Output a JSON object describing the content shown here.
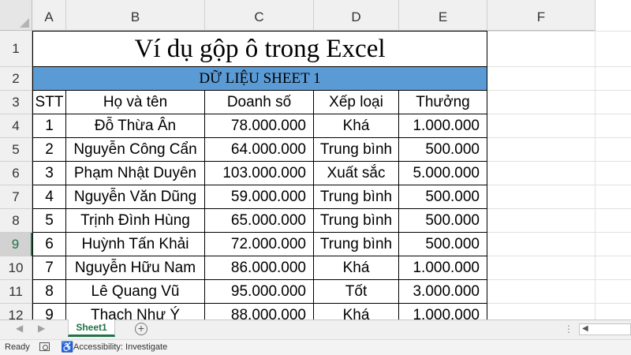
{
  "columns": [
    "A",
    "B",
    "C",
    "D",
    "E",
    "F"
  ],
  "rows": [
    "1",
    "2",
    "3",
    "4",
    "5",
    "6",
    "7",
    "8",
    "9",
    "10",
    "11",
    "12"
  ],
  "sheet": {
    "title": "Ví dụ gộp ô trong Excel",
    "band": "DỮ LIỆU SHEET 1",
    "headers": [
      "STT",
      "Họ và tên",
      "Doanh số",
      "Xếp loại",
      "Thưởng"
    ],
    "data": [
      [
        "1",
        "Đỗ Thừa Ân",
        "78.000.000",
        "Khá",
        "1.000.000"
      ],
      [
        "2",
        "Nguyễn Công Cẩn",
        "64.000.000",
        "Trung bình",
        "500.000"
      ],
      [
        "3",
        "Phạm Nhật Duyên",
        "103.000.000",
        "Xuất sắc",
        "5.000.000"
      ],
      [
        "4",
        "Nguyễn Văn Dũng",
        "59.000.000",
        "Trung bình",
        "500.000"
      ],
      [
        "5",
        "Trịnh Đình Hùng",
        "65.000.000",
        "Trung bình",
        "500.000"
      ],
      [
        "6",
        "Huỳnh Tấn Khải",
        "72.000.000",
        "Trung bình",
        "500.000"
      ],
      [
        "7",
        "Nguyễn Hữu Nam",
        "86.000.000",
        "Khá",
        "1.000.000"
      ],
      [
        "8",
        "Lê Quang Vũ",
        "95.000.000",
        "Tốt",
        "3.000.000"
      ],
      [
        "9",
        "Thạch Như Ý",
        "88.000.000",
        "Khá",
        "1.000.000"
      ]
    ]
  },
  "selected_row": "9",
  "band_color": "#5b9bd5",
  "accent_color": "#217346",
  "tabs": {
    "sheet1": "Sheet1",
    "add": "+"
  },
  "status": {
    "ready": "Ready",
    "accessibility": "Accessibility: Investigate"
  },
  "icons": {
    "nav_prev": "◀",
    "nav_next": "▶",
    "scroll_left": "◀",
    "dots": "⋮",
    "accessibility": "♿"
  }
}
